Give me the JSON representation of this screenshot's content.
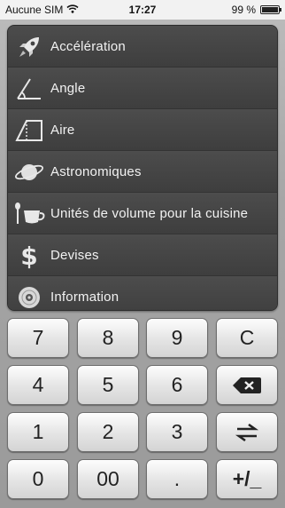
{
  "status_bar": {
    "carrier": "Aucune SIM",
    "time": "17:27",
    "battery_text": "99 %",
    "battery_level": 0.99
  },
  "categories": [
    {
      "label": "Accélération",
      "icon": "rocket-icon"
    },
    {
      "label": "Angle",
      "icon": "angle-icon"
    },
    {
      "label": "Aire",
      "icon": "area-icon"
    },
    {
      "label": "Astronomiques",
      "icon": "planet-icon"
    },
    {
      "label": "Unités de volume pour la cuisine",
      "icon": "cup-spoon-icon"
    },
    {
      "label": "Devises",
      "icon": "dollar-icon"
    },
    {
      "label": "Information",
      "icon": "disc-icon"
    }
  ],
  "keypad": {
    "k7": "7",
    "k8": "8",
    "k9": "9",
    "clear": "C",
    "k4": "4",
    "k5": "5",
    "k6": "6",
    "k1": "1",
    "k2": "2",
    "k3": "3",
    "k0": "0",
    "k00": "00",
    "dot": ".",
    "plusminus": "+/_"
  }
}
